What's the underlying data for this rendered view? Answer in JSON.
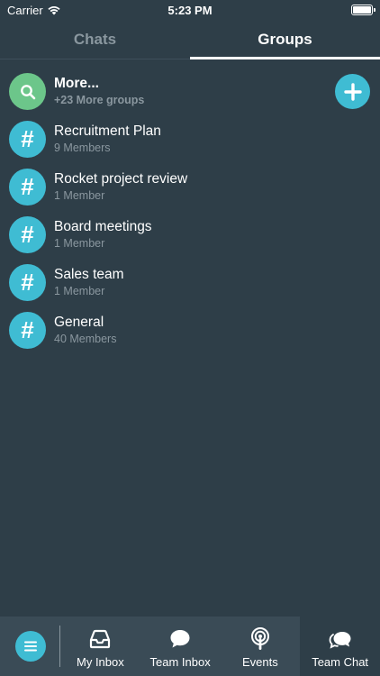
{
  "status_bar": {
    "carrier": "Carrier",
    "time": "5:23 PM"
  },
  "tabs": [
    {
      "label": "Chats",
      "active": false
    },
    {
      "label": "Groups",
      "active": true
    }
  ],
  "more": {
    "title": "More...",
    "subtitle": "+23 More groups"
  },
  "groups": [
    {
      "name": "Recruitment Plan",
      "members": "9 Members"
    },
    {
      "name": "Rocket project review",
      "members": "1 Member"
    },
    {
      "name": "Board meetings",
      "members": "1 Member"
    },
    {
      "name": "Sales team",
      "members": "1 Member"
    },
    {
      "name": "General",
      "members": "40 Members"
    }
  ],
  "avatar_glyph": "#",
  "bottom_nav": [
    {
      "label": "My Inbox",
      "icon": "inbox-icon"
    },
    {
      "label": "Team Inbox",
      "icon": "chat-bubble-icon"
    },
    {
      "label": "Events",
      "icon": "broadcast-icon"
    },
    {
      "label": "Team Chat",
      "icon": "team-chat-icon",
      "active": true
    }
  ],
  "colors": {
    "background": "#2e3e48",
    "accent": "#3fbcd3",
    "search_green": "#6cc68a",
    "muted_text": "#8a979f",
    "nav_bg": "#3a4b56"
  }
}
